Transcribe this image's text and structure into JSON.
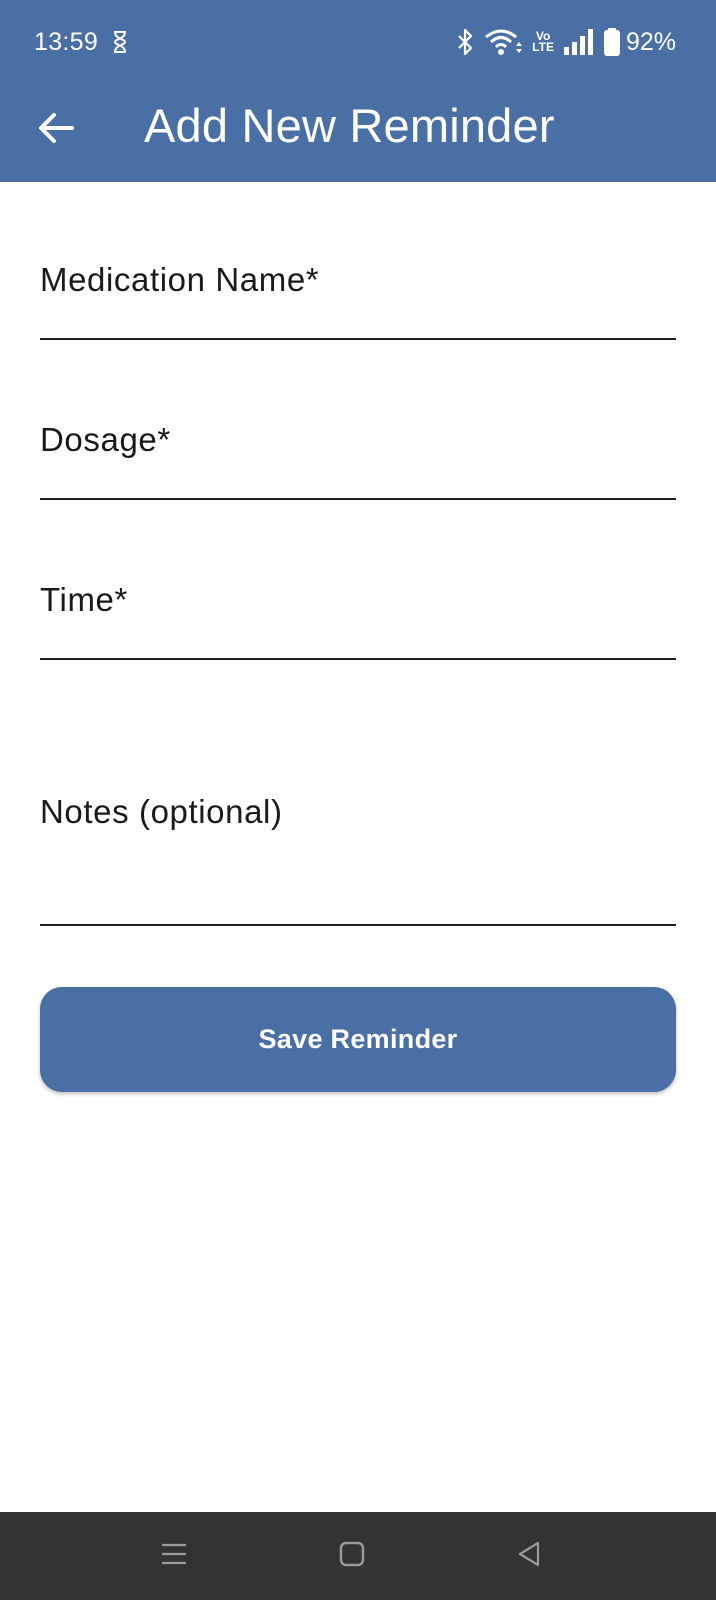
{
  "status_bar": {
    "time": "13:59",
    "battery_percent": "92%",
    "volte_top": "Vo",
    "volte_bottom": "LTE",
    "icons": [
      "hourglass-icon",
      "bluetooth-icon",
      "wifi-icon",
      "volte-icon",
      "signal-icon",
      "battery-icon"
    ]
  },
  "app_bar": {
    "title": "Add New Reminder",
    "back_icon": "arrow-back-icon"
  },
  "form": {
    "fields": [
      {
        "label": "Medication Name*",
        "value": ""
      },
      {
        "label": "Dosage*",
        "value": ""
      },
      {
        "label": "Time*",
        "value": ""
      },
      {
        "label": "Notes (optional)",
        "value": ""
      }
    ],
    "submit_label": "Save Reminder"
  },
  "nav_bar": {
    "icons": [
      "recent-apps-icon",
      "home-icon",
      "back-nav-icon"
    ]
  },
  "colors": {
    "primary": "#4a6fa5",
    "nav_bar": "#333333",
    "background": "#ffffff",
    "text": "#1a1a1a"
  }
}
